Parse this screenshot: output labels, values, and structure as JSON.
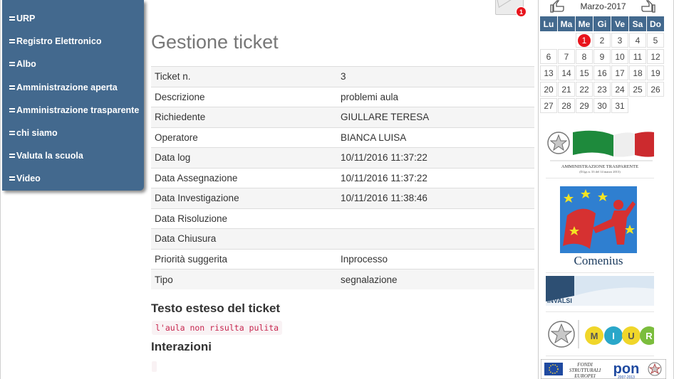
{
  "nav": {
    "items": [
      {
        "label": "URP"
      },
      {
        "label": "Registro Elettronico"
      },
      {
        "label": "Albo"
      },
      {
        "label": "Amministrazione aperta"
      },
      {
        "label": "Amministrazione trasparente"
      },
      {
        "label": "chi siamo"
      },
      {
        "label": "Valuta la scuola"
      },
      {
        "label": "Video"
      }
    ]
  },
  "mail": {
    "badge": "1",
    "icon": "envelope-icon"
  },
  "main": {
    "title": "Gestione ticket",
    "rows": [
      {
        "label": "Ticket n.",
        "value": "3"
      },
      {
        "label": "Descrizione",
        "value": "problemi aula"
      },
      {
        "label": "Richiedente",
        "value": "GIULLARE TERESA"
      },
      {
        "label": "Operatore",
        "value": "BIANCA LUISA"
      },
      {
        "label": "Data log",
        "value": "10/11/2016 11:37:22"
      },
      {
        "label": "Data Assegnazione",
        "value": "10/11/2016 11:37:22"
      },
      {
        "label": "Data Investigazione",
        "value": "10/11/2016 11:38:46"
      },
      {
        "label": "Data Risoluzione",
        "value": ""
      },
      {
        "label": "Data Chiusura",
        "value": ""
      },
      {
        "label": "Priorità suggerita",
        "value": "Inprocesso"
      },
      {
        "label": "Tipo",
        "value": "segnalazione"
      }
    ],
    "extended_heading": "Testo esteso del ticket",
    "extended_text": "l'aula non risulta pulita",
    "interactions_heading": "Interazioni",
    "interactions_text": ""
  },
  "calendar": {
    "month": "Marzo-2017",
    "prev_icon": "thumb-left-icon",
    "next_icon": "thumb-right-icon",
    "weekdays": [
      "Lu",
      "Ma",
      "Me",
      "Gi",
      "Ve",
      "Sa",
      "Do"
    ],
    "weeks": [
      [
        "",
        "",
        "1",
        "2",
        "3",
        "4",
        "5"
      ],
      [
        "6",
        "7",
        "8",
        "9",
        "10",
        "11",
        "12"
      ],
      [
        "13",
        "14",
        "15",
        "16",
        "17",
        "18",
        "19"
      ],
      [
        "20",
        "21",
        "22",
        "23",
        "24",
        "25",
        "26"
      ],
      [
        "27",
        "28",
        "29",
        "30",
        "31",
        "",
        ""
      ]
    ],
    "today": "1",
    "today_color": "#e8141c"
  },
  "banners": {
    "trasparente_text": "AMMINISTRAZIONE TRASPARENTE",
    "trasparente_sub": "(D.lgs n. 33 del 14 marzo 2013)",
    "comenius_text": "Comenius",
    "invalsi_text": "INVALSI",
    "miur_letters": [
      "M",
      "I",
      "U",
      "R"
    ],
    "pon_fondi": "FONDI",
    "pon_strutturali": "STRUTTURALI",
    "pon_europei": "EUROPEI",
    "pon_text": "pon",
    "pon_years": "2007-2013"
  },
  "colors": {
    "accent": "#43698e",
    "badge": "#e8141c",
    "code": "#c7254e"
  }
}
